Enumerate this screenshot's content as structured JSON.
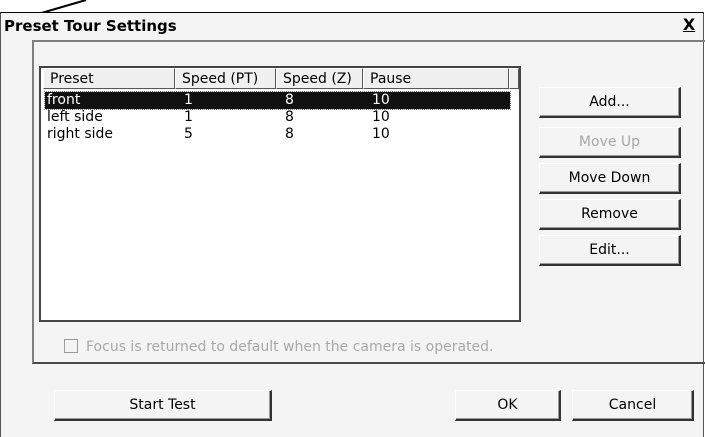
{
  "dialog": {
    "title": "Preset Tour Settings",
    "close_glyph": "X"
  },
  "list": {
    "columns": [
      "Preset",
      "Speed (PT)",
      "Speed (Z)",
      "Pause"
    ],
    "rows": [
      {
        "preset": "front",
        "speed_pt": "1",
        "speed_z": "8",
        "pause": "10",
        "selected": true
      },
      {
        "preset": "left side",
        "speed_pt": "1",
        "speed_z": "8",
        "pause": "10",
        "selected": false
      },
      {
        "preset": "right side",
        "speed_pt": "5",
        "speed_z": "8",
        "pause": "10",
        "selected": false
      }
    ]
  },
  "side_buttons": {
    "add": "Add...",
    "move_up": "Move Up",
    "move_down": "Move Down",
    "remove": "Remove",
    "edit": "Edit..."
  },
  "focus_option": {
    "label": "Focus is returned to default when the camera is operated.",
    "checked": false,
    "enabled": false
  },
  "bottom_buttons": {
    "start_test": "Start Test",
    "ok": "OK",
    "cancel": "Cancel"
  }
}
